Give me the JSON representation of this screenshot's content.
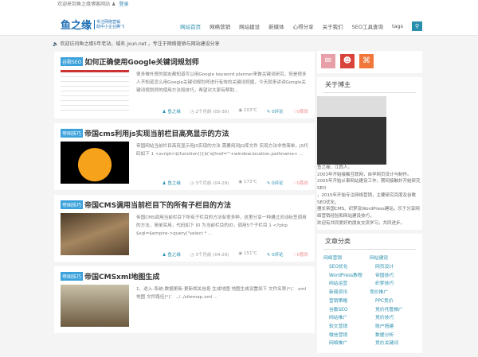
{
  "topbar": {
    "welcome": "欢迎来到鱼之缘博客网站",
    "login": "登录"
  },
  "header": {
    "logo": "鱼之缘",
    "slogan1": "专注网络营销",
    "slogan2": "助中小企业腾飞",
    "nav": [
      "网站首页",
      "网络营销",
      "网站建设",
      "新媒体",
      "心得分享",
      "关于我们",
      "SEO工具查询",
      "tags"
    ]
  },
  "notice": "欢迎访问鱼之缘5年老站，域名 jxun.net ，专注于网络营销与网站建设分享",
  "posts": [
    {
      "tag": "谷歌SEO",
      "title": "如何正确使用Google关键词规划师",
      "excerpt": "很多做外贸的朋友都知道可以用Google keyword planner来做关键词研究，但是很多人不知道怎么用Google关键词规划师进行有效的关键词挖掘，今天就来讲讲Google关键词规划师的使用方法和技巧，希望对大家有帮助...",
      "author": "鱼之缘",
      "time": "2个月前 (05-30)",
      "views": "103℃",
      "comments": "0评论",
      "likes": "0喜欢"
    },
    {
      "tag": "帝国技巧",
      "title": "帝国cms利用js实现当前栏目高亮显示的方法",
      "excerpt": "帝国网站当前栏目高亮显示用JS实现的方法 需要用到JQ库文件 实现方法非常简单，JS代码如下 1 <script>$(function(){$('a[href=\"'+window.location.pathname+ ...",
      "author": "鱼之缘",
      "time": "3个月前 (04-29)",
      "views": "173℃",
      "comments": "0评论",
      "likes": "0喜欢"
    },
    {
      "tag": "帝国技巧",
      "title": "帝国CMS调用当前栏目下的所有子栏目的方法",
      "excerpt": "帝国CMS调用当前栏目下所有子栏目的方法有很多种，这里分享一种通过灵动标签调用的方法，简单实用，代码如下   ID 为当前栏目的ID，调用5个子栏目 1 <?php $sql=$empire->query(\"select * ...",
      "author": "鱼之缘",
      "time": "3个月前 (04-29)",
      "views": "151℃",
      "comments": "0评论",
      "likes": "0喜欢"
    },
    {
      "tag": "帝国技巧",
      "title": "帝国CMSxml地图生成",
      "excerpt": "1、进入-系统-数据更新-更新相关信息   生成地图    地图生成设置如下 文件名称(*)： xml地图 文件路径(*)： ../../sitemap.xml ..."
    }
  ],
  "sidebar": {
    "social": [
      "email-icon",
      "qq-icon",
      "rss-icon"
    ],
    "about_title": "关于博主",
    "about": [
      "鱼之缘，江西人。",
      "2003年开始接触互联网，自学网页设计与制作。",
      "2005年开始从事网站建设工作，期间接触并开始研究SEO",
      "，2015年开始专注网络营销，主要研究百度及谷歌SEO优化，",
      "擅长帝国CMS、织梦及WordPress建站，乐于分享网络营销经验和网站建设技巧，",
      "欢迎有共同爱好的朋友交流学习，共同进步。"
    ],
    "cat_title": "文章分类",
    "cats_left": {
      "head": "网络营销",
      "items": [
        "SEO优化",
        "WordPress教程",
        "网站运营",
        "新闻资讯",
        "营销策略",
        "谷歌SEO",
        "网站推广",
        "软文营销",
        "微信营销",
        "网络推广"
      ]
    },
    "cats_right": [
      {
        "head": "网站建设",
        "items": [
          "网页设计",
          "帝国技巧",
          "织梦技巧"
        ]
      },
      {
        "head": "竞价推广",
        "items": [
          "PPC竞价",
          "竞价托管推广",
          "竞价技巧",
          "账户搭建",
          "数据分析",
          "竞价关键词"
        ]
      }
    ]
  }
}
